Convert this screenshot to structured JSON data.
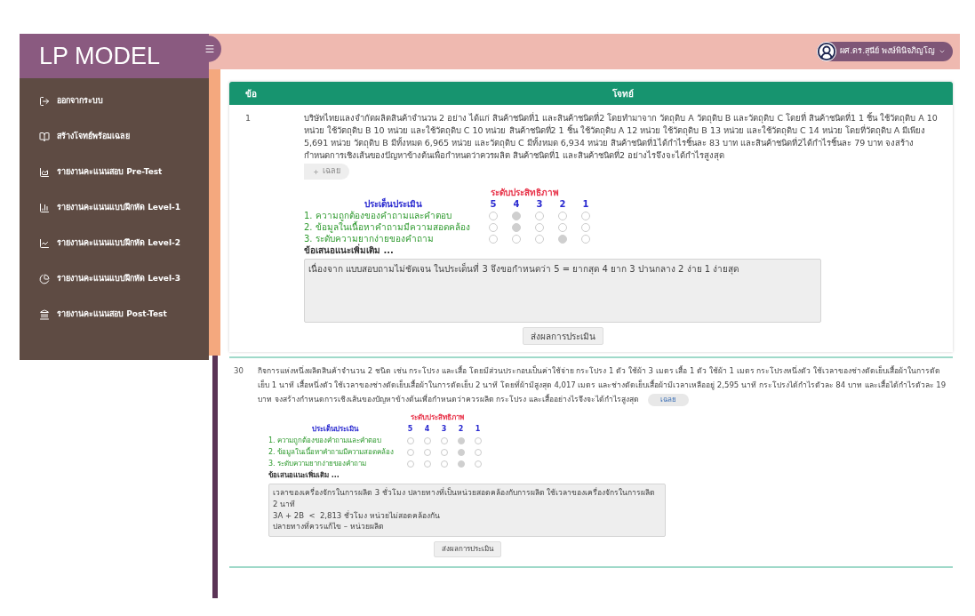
{
  "brand": "LP MODEL",
  "user": {
    "name": "ผศ.ดร.สุนีย์ พงษ์พินิจภิญโญ"
  },
  "sidebar": {
    "items": [
      {
        "label": "ออกจากระบบ"
      },
      {
        "label": "สร้างโจทย์พร้อมเฉลย"
      },
      {
        "label": "รายงานคะแนนสอบ Pre-Test"
      },
      {
        "label": "รายงานคะแนนแบบฝึกหัด Level-1"
      },
      {
        "label": "รายงานคะแนนแบบฝึกหัด Level-2"
      },
      {
        "label": "รายงานคะแนนแบบฝึกหัด Level-3"
      },
      {
        "label": "รายงานคะแนนสอบ Post-Test"
      }
    ]
  },
  "table": {
    "columns": [
      "ข้อ",
      "โจทย์"
    ],
    "rows": [
      {
        "kind": "full",
        "number": "1",
        "question": "บริษัทไทยแลงจำกัดผลิตสินค้าจำนวน 2 อย่าง ได้แก่ สินค้าชนิดที่1 และสินค้าชนิดที่2 โดยทำมาจาก วัตถุดิบ A วัตถุดิบ B และวัตถุดิบ C โดยที่ สินค้าชนิดที่1 1 ชิ้น ใช้วัตถุดิบ A 10 หน่วย ใช้วัตถุดิบ B 10 หน่วย และใช้วัตถุดิบ C 10 หน่วย สินค้าชนิดที่2 1 ชิ้น ใช้วัตถุดิบ A 12 หน่วย ใช้วัตถุดิบ B 13 หน่วย และใช้วัตถุดิบ C 14 หน่วย โดยที่วัตถุดิบ A มีเพียง 5,691 หน่วย วัตถุดิบ B มีทั้งหมด 6,965 หน่วย และวัตถุดิบ C มีทั้งหมด 6,934 หน่วย สินค้าชนิดที่1ได้กำไรชิ้นละ 83 บาท และสินค้าชนิดที่2ได้กำไรชิ้นละ 79 บาท จงสร้างกำหนดการเชิงเส้นของปัญหาข้างต้นเพื่อกำหนดว่าควรผลิต สินค้าชนิดที่1 และสินค้าชนิดที่2 อย่างไรจึงจะได้กำไรสูงสุด",
        "answer_button": "เฉลย",
        "scale_title": "ระดับประสิทธิภาพ",
        "criteria_title": "ประเด็นประเมิน",
        "scale": [
          "5",
          "4",
          "3",
          "2",
          "1"
        ],
        "criteria": [
          {
            "label": "1. ความถูกต้องของคำถามและคำตอบ",
            "options": [
              {
                "selected": false
              },
              {
                "selected": true
              },
              {
                "selected": false
              },
              {
                "selected": false
              },
              {
                "selected": false
              }
            ]
          },
          {
            "label": "2. ข้อมูลในเนื้อหาคำถามมีความสอดคล้อง",
            "options": [
              {
                "selected": false
              },
              {
                "selected": true
              },
              {
                "selected": false
              },
              {
                "selected": false
              },
              {
                "selected": false
              }
            ]
          },
          {
            "label": "3. ระดับความยากง่ายของคำถาม",
            "options": [
              {
                "selected": false
              },
              {
                "selected": false
              },
              {
                "selected": false
              },
              {
                "selected": true
              },
              {
                "selected": false
              }
            ]
          }
        ],
        "comment_label": "ข้อเสนอแนะเพิ่มเติม ...",
        "comment": "เนื่องจาก แบบสอบถามไม่ชัดเจน ในประเด็นที่ 3 จึงขอกำหนดว่า 5 = ยากสุด 4 ยาก 3 ปานกลาง 2 ง่าย 1 ง่ายสุด",
        "submit_button": "ส่งผลการประเมิน"
      },
      {
        "kind": "compact",
        "number": "30",
        "question": "กิจการแห่งหนึ่งผลิตสินค้าจำนวน 2 ชนิด เช่น กระโปรง และเสื้อ โดยมีส่วนประกอบเป็นค่าใช้จ่าย กระโปรง 1 ตัว ใช้ผ้า 3 เมตร เสื้อ 1 ตัว ใช้ผ้า 1 เมตร กระโปรงหนึ่งตัว ใช้เวลาของช่างตัดเย็บเสื้อผ้าในการตัดเย็บ 1 นาที เสื้อหนึ่งตัว ใช้เวลาของช่างตัดเย็บเสื้อผ้าในการตัดเย็บ 2 นาที โดยที่ผ้ามีสูงสุด 4,017 เมตร และช่างตัดเย็บเสื้อผ้ามีเวลาเหลืออยู่ 2,595 นาที กระโปรงได้กำไรตัวละ 84 บาท และเสื้อได้กำไรตัวละ 19 บาท จงสร้างกำหนดการเชิงเส้นของปัญหาข้างต้นเพื่อกำหนดว่าควรผลิต กระโปรง และเสื้ออย่างไรจึงจะได้กำไรสูงสุด",
        "answer_button": "เฉลย",
        "scale_title": "ระดับประสิทธิภาพ",
        "criteria_title": "ประเด็นประเมิน",
        "scale": [
          "5",
          "4",
          "3",
          "2",
          "1"
        ],
        "criteria": [
          {
            "label": "1. ความถูกต้องของคำถามและคำตอบ",
            "options": [
              {
                "selected": false
              },
              {
                "selected": false
              },
              {
                "selected": false
              },
              {
                "selected": true
              },
              {
                "selected": false
              }
            ]
          },
          {
            "label": "2. ข้อมูลในเนื้อหาคำถามมีความสอดคล้อง",
            "options": [
              {
                "selected": false
              },
              {
                "selected": false
              },
              {
                "selected": false
              },
              {
                "selected": true
              },
              {
                "selected": false
              }
            ]
          },
          {
            "label": "3. ระดับความยากง่ายของคำถาม",
            "options": [
              {
                "selected": false
              },
              {
                "selected": false
              },
              {
                "selected": false
              },
              {
                "selected": true
              },
              {
                "selected": false
              }
            ]
          }
        ],
        "comment_label": "ข้อเสนอแนะเพิ่มเติม ...",
        "comment": "เวลาของเครื่องจักรในการผลิต 3 ชั่วโมง ปลายทางที่เป็นหน่วยสอดคล้องกับการผลิต ใช้เวลาของเครื่องจักรในการผลิต 2 นาที\n3A + 2B  <  2,813 ชั่วโมง หน่วยไม่สอดคล้องกัน\nปลายทางที่ควรแก้ไข – หน่วยผลิต",
        "submit_button": "ส่งผลการประเมิน"
      }
    ]
  }
}
